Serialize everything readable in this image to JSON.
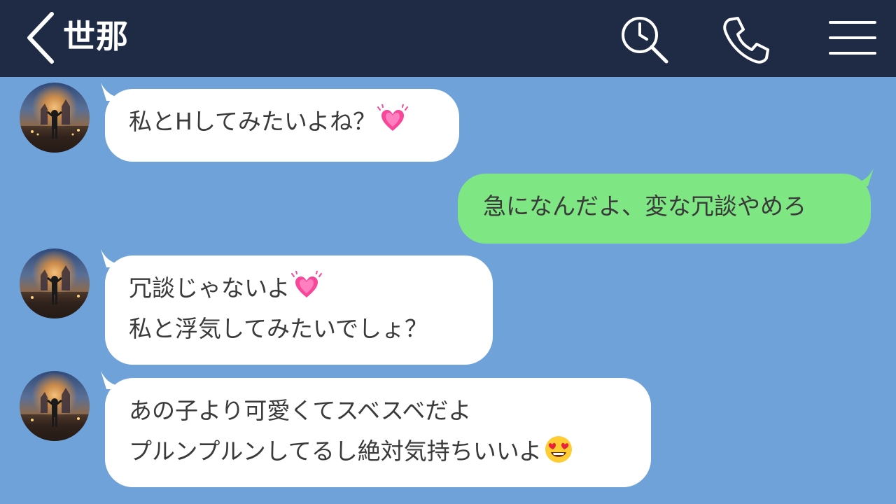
{
  "header": {
    "title": "世那",
    "background": "#1f2a45",
    "icons": [
      "chevron-left-icon",
      "search-history-icon",
      "phone-icon",
      "menu-icon"
    ]
  },
  "chat": {
    "background": "#6ea2d8",
    "incoming_bubble_color": "#ffffff",
    "outgoing_bubble_color": "#7ee682",
    "messages": [
      {
        "side": "incoming",
        "lines": [
          "私とHしてみたいよね？"
        ],
        "emoji": "growing-heart-emoji"
      },
      {
        "side": "outgoing",
        "lines": [
          "急になんだよ、変な冗談やめろ"
        ]
      },
      {
        "side": "incoming",
        "lines": [
          "冗談じゃないよ",
          "私と浮気してみたいでしょ？"
        ],
        "emoji": "growing-heart-emoji"
      },
      {
        "side": "incoming",
        "lines": [
          "あの子より可愛くてスベスベだよ",
          "プルンプルンしてるし絶対気持ちいいよ"
        ],
        "emoji": "heart-eyes-emoji"
      }
    ]
  }
}
